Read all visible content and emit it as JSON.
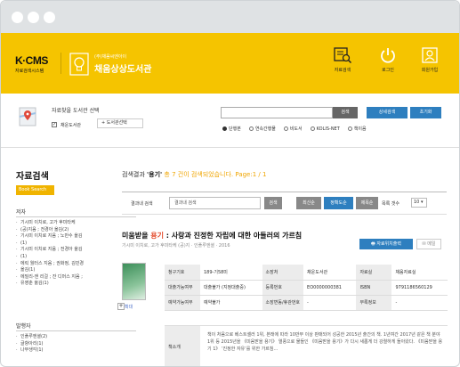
{
  "header": {
    "logo_title": "K·CMS",
    "logo_sub": "자료검색시스템",
    "library_small": "(주)채움씨엔아이",
    "library_name": "채움상상도서관",
    "nav": [
      {
        "label": "자료검색",
        "icon": "book-search-icon"
      },
      {
        "label": "로그인",
        "icon": "power-icon"
      },
      {
        "label": "회원가입",
        "icon": "user-add-icon"
      }
    ],
    "accent": "#f5c400"
  },
  "selector": {
    "title": "자료찾을 도서관 선택",
    "checkbox_label": "채운도서관",
    "add_label": "+ 도서관선택"
  },
  "search": {
    "query": "",
    "search_label": "검색",
    "advanced_label": "상세검색",
    "reset_label": "초기화",
    "modes": [
      "단행본",
      "연속간행물",
      "비도서",
      "KOLIS-NET",
      "책이음"
    ],
    "selected_mode": "단행본"
  },
  "sidebar": {
    "title": "자료검색",
    "badge": "Book Search",
    "author_heading": "저자",
    "authors": [
      "기시미 이치로, 고가 후미타케",
      "(공)지음 ; 전경아 옮김(2)",
      "기시미 이치로 지음 ; 노만수 옮김",
      "(1)",
      "기시미 이치로 지음 ; 전경아 옮김",
      "(1)",
      "에릭 월터스 지음 ; 권화정, 김민경",
      "옮김(1)",
      "에밀리-앤 리걸 ; 잔 디머스 지음 ;",
      "유영춘 옮김(1)"
    ],
    "publisher_heading": "발행자",
    "publishers": [
      "인플루엔셜(2)",
      "글항아리(1)",
      "나무생각(1)"
    ]
  },
  "results": {
    "prefix": "검색결과",
    "keyword": "'용기'",
    "count_text": "총 7 건이 검색되었습니다.",
    "page_text": "Page:1 / 1",
    "within_label": "결과내 검색",
    "within_value": "결과내 검색",
    "within_btn": "검색",
    "sort_buttons": [
      "최신순",
      "정확도순",
      "제목순"
    ],
    "active_sort": "정확도순",
    "per_page_label": "목록 갯수",
    "per_page_value": "10"
  },
  "book": {
    "title_prefix": "미움받을",
    "title_highlight": "용기",
    "title_rest": ": 사랑과 진정한 자립에 대한 아들러의 가르침",
    "meta": "기시미 이치로, 고가 후미타케 (공)지 · 인플루엔셜 · 2016",
    "print_label": "자료위치출력",
    "mail_label": "메일",
    "cover_caption": "확대",
    "details": [
      [
        "청구기호",
        "189-기58미",
        "소장처",
        "채운도서관",
        "자료실",
        "채움자료실"
      ],
      [
        "대출가능여부",
        "대출불가\n(지정대출중)",
        "등록번호",
        "EO0000000381",
        "ISBN",
        "9791186560129"
      ],
      [
        "예약가능여부",
        "예약불가",
        "소장변동/휴관번호",
        "-",
        "부록정보",
        "-"
      ]
    ],
    "desc_label": "책소개",
    "description": "책이 처음으로 베스트셀러 1위, 본래에 따라 10만부 이상 판매되어 성공한 2015년 출간의 책. 1년여간 2017년 같은 책 분야 1위 등 2015년을 《미움받을 용기》 열풍으로 물들인 《미움받을 용기》가 다시 새롭게 더 강렬하게 돌아왔다. 《미움받을 용기 1》 ‘진정한 자유’를 위한 가르침..."
  }
}
